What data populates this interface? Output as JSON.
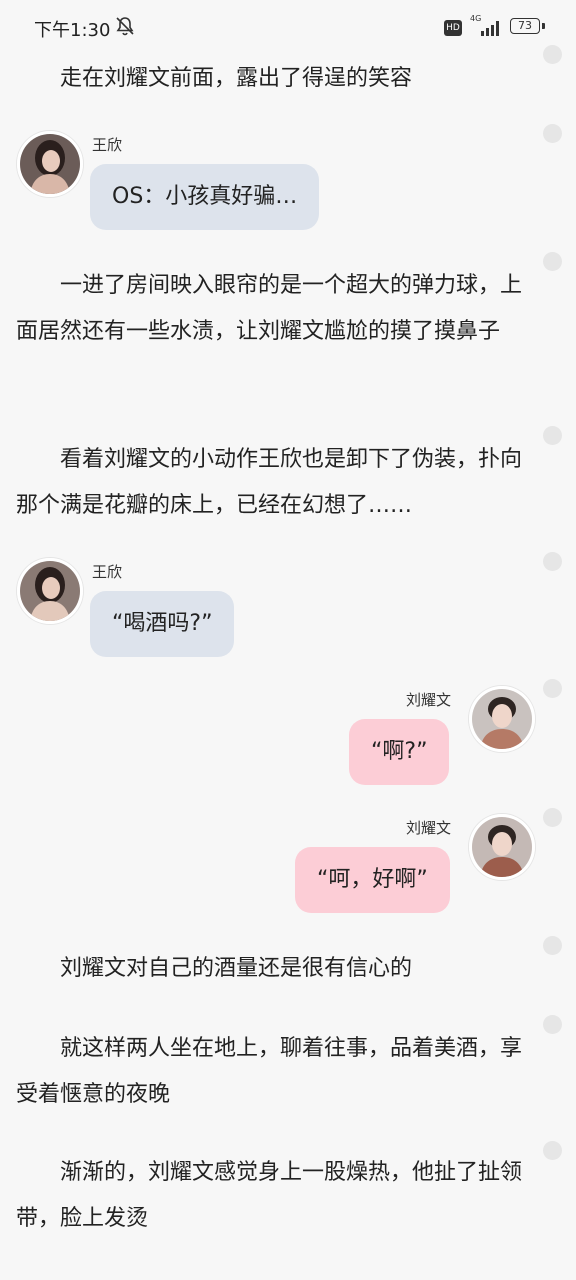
{
  "status_bar": {
    "time": "下午1:30",
    "hd": "HD",
    "network": "4G",
    "battery": "73"
  },
  "paragraphs": [
    "走在刘耀文前面，露出了得逞的笑容",
    "一进了房间映入眼帘的是一个超大的弹力球，上面居然还有一些水渍，让刘耀文尴尬的摸了摸鼻子",
    "看着刘耀文的小动作王欣也是卸下了伪装，扑向那个满是花瓣的床上，已经在幻想了……",
    "刘耀文对自己的酒量还是很有信心的",
    "就这样两人坐在地上，聊着往事，品着美酒，享受着惬意的夜晚",
    "渐渐的，刘耀文感觉身上一股燥热，他扯了扯领带，脸上发烫"
  ],
  "messages": [
    {
      "speaker": "王欣",
      "text": "OS：小孩真好骗…"
    },
    {
      "speaker": "王欣",
      "text": "“喝酒吗?”"
    },
    {
      "speaker": "刘耀文",
      "text": "“啊?”"
    },
    {
      "speaker": "刘耀文",
      "text": "“呵，好啊”"
    }
  ]
}
